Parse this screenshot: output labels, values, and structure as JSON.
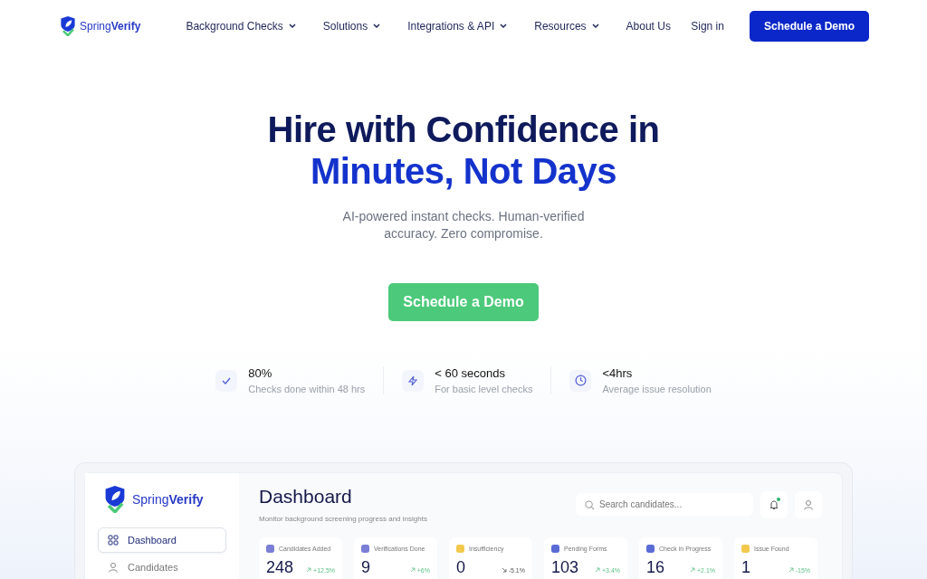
{
  "nav": {
    "logo": "Spring**Verify**",
    "items": [
      {
        "label": "Background Checks",
        "dropdown": true
      },
      {
        "label": "Solutions",
        "dropdown": true
      },
      {
        "label": "Integrations & API",
        "dropdown": true
      },
      {
        "label": "Resources",
        "dropdown": true
      },
      {
        "label": "About Us",
        "dropdown": false
      }
    ],
    "sign_in": "Sign in",
    "cta": "Schedule a Demo"
  },
  "hero": {
    "title_line1": "Hire with Confidence in",
    "title_line2": "Minutes, Not Days",
    "subtitle": "AI-powered instant checks. Human-verified accuracy. Zero compromise.",
    "cta": "Schedule a Demo"
  },
  "stats": [
    {
      "kind": "check",
      "value": "80%",
      "caption": "Checks done within 48 hrs"
    },
    {
      "kind": "bolt",
      "value": "< 60 seconds",
      "caption": "For basic level checks"
    },
    {
      "kind": "clock",
      "value": "<4hrs",
      "caption": "Average issue resolution"
    }
  ],
  "dashboard": {
    "logo": "Spring**Verify**",
    "sidebar": [
      {
        "label": "Dashboard",
        "kind": "grid",
        "selected": true
      },
      {
        "label": "Candidates",
        "kind": "person",
        "selected": false
      }
    ],
    "title": "Dashboard",
    "subtitle": "Monitor background screening progress and insights",
    "search": {
      "placeholder": "Search candidates..."
    },
    "notification": true,
    "cards": [
      {
        "label": "Candidates Added",
        "value": "248",
        "change": "+12.5%",
        "kind": "up",
        "color": "#7b7fd6"
      },
      {
        "label": "Verifications Done",
        "value": "9",
        "change": "+6%",
        "kind": "up",
        "color": "#7b7fd6"
      },
      {
        "label": "Insufficiency",
        "value": "0",
        "change": "-5.1%",
        "kind": "down",
        "color": "#f2c94c"
      },
      {
        "label": "Pending Forms",
        "value": "103",
        "change": "+3.4%",
        "kind": "up",
        "color": "#5b6bd6"
      },
      {
        "label": "Check in Progress",
        "value": "16",
        "change": "+2.1%",
        "kind": "up",
        "color": "#5b6bd6"
      },
      {
        "label": "Issue Found",
        "value": "1",
        "change": "-15%",
        "kind": "up",
        "color": "#f2c94c"
      }
    ]
  }
}
